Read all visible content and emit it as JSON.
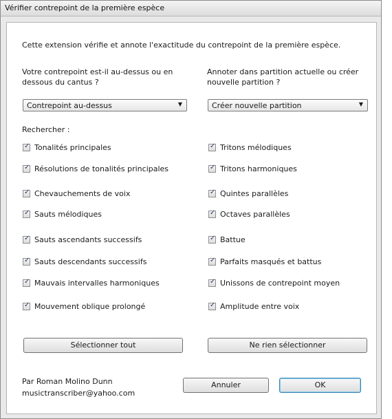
{
  "window": {
    "title": "Vérifier contrepoint de la première espèce"
  },
  "description": "Cette extension vérifie et annote l'exactitude du contrepoint de la première espèce.",
  "question_left": "Votre contrepoint est-il au-dessus ou en dessous du cantus ?",
  "question_right": "Annoter dans partition actuelle ou créer nouvelle partition ?",
  "combo_left": {
    "value": "Contrepoint au-dessus",
    "icon": "chevron-down-icon"
  },
  "combo_right": {
    "value": "Créer nouvelle partition",
    "icon": "chevron-down-icon"
  },
  "search_label": "Rechercher :",
  "checks_left": [
    {
      "label": "Tonalités principales",
      "checked": true
    },
    {
      "label": "Résolutions de tonalités principales",
      "checked": true
    },
    {
      "label": "Chevauchements de voix",
      "checked": true
    },
    {
      "label": "Sauts mélodiques",
      "checked": true
    },
    {
      "label": "Sauts ascendants successifs",
      "checked": true
    },
    {
      "label": "Sauts descendants successifs",
      "checked": true
    },
    {
      "label": "Mauvais intervalles harmoniques",
      "checked": true
    },
    {
      "label": "Mouvement oblique prolongé",
      "checked": true
    }
  ],
  "checks_right": [
    {
      "label": "Tritons mélodiques",
      "checked": true
    },
    {
      "label": "Tritons harmoniques",
      "checked": true
    },
    {
      "label": "Quintes parallèles",
      "checked": true
    },
    {
      "label": "Octaves parallèles",
      "checked": true
    },
    {
      "label": "Battue",
      "checked": true
    },
    {
      "label": "Parfaits masqués et battus",
      "checked": true
    },
    {
      "label": "Unissons de contrepoint moyen",
      "checked": true
    },
    {
      "label": "Amplitude entre voix",
      "checked": true
    }
  ],
  "buttons": {
    "select_all": "Sélectionner tout",
    "select_none": "Ne rien sélectionner",
    "cancel": "Annuler",
    "ok": "OK"
  },
  "author": {
    "name": "Par Roman Molino Dunn",
    "email": "musictranscriber@yahoo.com"
  }
}
